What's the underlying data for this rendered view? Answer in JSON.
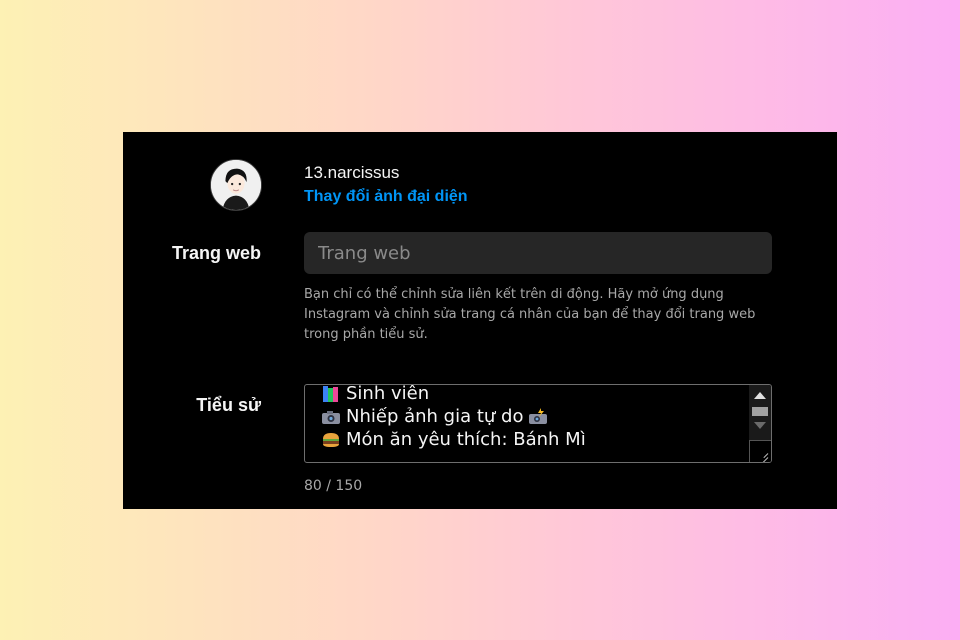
{
  "profile": {
    "username": "13.narcissus",
    "change_photo": "Thay đổi ảnh đại diện"
  },
  "website": {
    "label": "Trang web",
    "placeholder": "Trang web",
    "help": "Bạn chỉ có thể chỉnh sửa liên kết trên di động. Hãy mở ứng dụng Instagram và chỉnh sửa trang cá nhân của bạn để thay đổi trang web trong phần tiểu sử."
  },
  "bio": {
    "label": "Tiểu sử",
    "lines": [
      {
        "icon": "books-emoji",
        "text": "Sinh viên"
      },
      {
        "icon": "camera-emoji",
        "text": "Nhiếp ảnh gia tự do",
        "trailing_icon": "camera-flash-emoji"
      },
      {
        "icon": "burger-emoji",
        "text": "Món ăn yêu thích: Bánh Mì"
      }
    ],
    "counter": "80 / 150"
  },
  "colors": {
    "link": "#0095f6",
    "panel": "#000000",
    "input_bg": "#262626"
  }
}
